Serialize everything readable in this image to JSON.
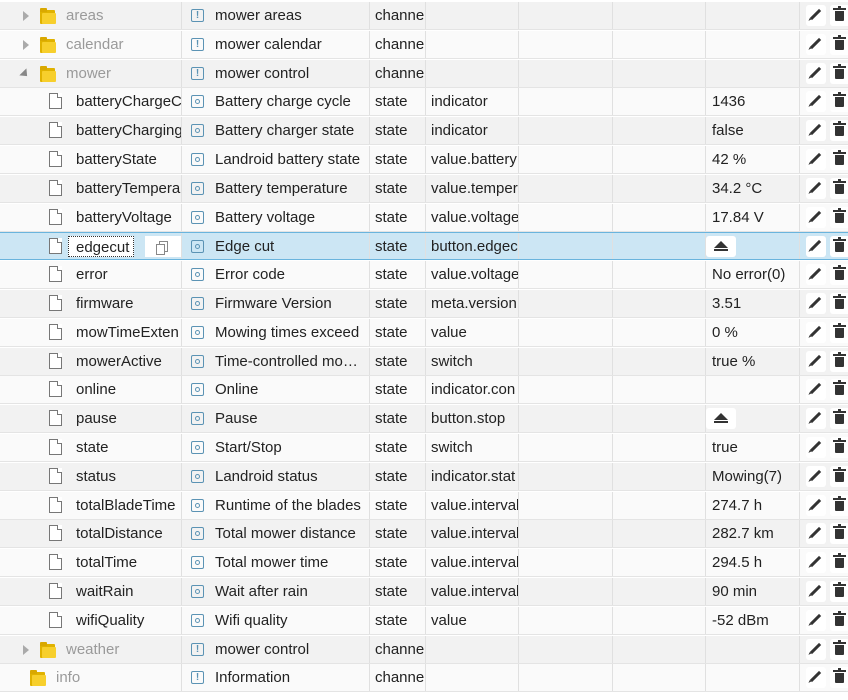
{
  "rows": [
    {
      "kind": "folder",
      "state": "closed",
      "level": 1,
      "id": "areas",
      "name": "mower areas",
      "type": "channe",
      "role": "",
      "value": ""
    },
    {
      "kind": "folder",
      "state": "closed",
      "level": 1,
      "id": "calendar",
      "name": "mower calendar",
      "type": "channe",
      "role": "",
      "value": ""
    },
    {
      "kind": "folder",
      "state": "open",
      "level": 1,
      "id": "mower",
      "name": "mower control",
      "type": "channe",
      "role": "",
      "value": ""
    },
    {
      "kind": "state",
      "id": "batteryChargeC",
      "name": "Battery charge cycle",
      "type": "state",
      "role": "indicator",
      "value": "1436"
    },
    {
      "kind": "state",
      "id": "batteryCharging",
      "name": "Battery charger state",
      "type": "state",
      "role": "indicator",
      "value": "false"
    },
    {
      "kind": "state",
      "id": "batteryState",
      "name": "Landroid battery state",
      "type": "state",
      "role": "value.battery",
      "value": "42 %"
    },
    {
      "kind": "state",
      "id": "batteryTempera",
      "name": "Battery temperature",
      "type": "state",
      "role": "value.temper",
      "value": "34.2 °C"
    },
    {
      "kind": "state",
      "id": "batteryVoltage",
      "name": "Battery voltage",
      "type": "state",
      "role": "value.voltage",
      "value": "17.84 V"
    },
    {
      "kind": "state",
      "id": "edgecut",
      "name": "Edge cut",
      "type": "state",
      "role": "button.edgec",
      "value": "",
      "button": true,
      "selected": true
    },
    {
      "kind": "state",
      "id": "error",
      "name": "Error code",
      "type": "state",
      "role": "value.voltage",
      "value": "No error(0)"
    },
    {
      "kind": "state",
      "id": "firmware",
      "name": "Firmware Version",
      "type": "state",
      "role": "meta.version",
      "value": "3.51"
    },
    {
      "kind": "state",
      "id": "mowTimeExten",
      "name": "Mowing times exceed",
      "type": "state",
      "role": "value",
      "value": "0 %"
    },
    {
      "kind": "state",
      "id": "mowerActive",
      "name": "Time-controlled mow…",
      "type": "state",
      "role": "switch",
      "value": "true %"
    },
    {
      "kind": "state",
      "id": "online",
      "name": "Online",
      "type": "state",
      "role": "indicator.con",
      "value": ""
    },
    {
      "kind": "state",
      "id": "pause",
      "name": "Pause",
      "type": "state",
      "role": "button.stop",
      "value": "",
      "button": true
    },
    {
      "kind": "state",
      "id": "state",
      "name": "Start/Stop",
      "type": "state",
      "role": "switch",
      "value": "true"
    },
    {
      "kind": "state",
      "id": "status",
      "name": "Landroid status",
      "type": "state",
      "role": "indicator.stat",
      "value": "Mowing(7)"
    },
    {
      "kind": "state",
      "id": "totalBladeTime",
      "name": "Runtime of the blades",
      "type": "state",
      "role": "value.interval",
      "value": "274.7 h"
    },
    {
      "kind": "state",
      "id": "totalDistance",
      "name": "Total mower distance",
      "type": "state",
      "role": "value.interval",
      "value": "282.7 km"
    },
    {
      "kind": "state",
      "id": "totalTime",
      "name": "Total mower time",
      "type": "state",
      "role": "value.interval",
      "value": "294.5 h"
    },
    {
      "kind": "state",
      "id": "waitRain",
      "name": "Wait after rain",
      "type": "state",
      "role": "value.interval",
      "value": "90 min"
    },
    {
      "kind": "state",
      "id": "wifiQuality",
      "name": "Wifi quality",
      "type": "state",
      "role": "value",
      "value": "-52 dBm"
    },
    {
      "kind": "folder",
      "state": "closed",
      "level": 1,
      "id": "weather",
      "name": "mower control",
      "type": "channe",
      "role": "",
      "value": ""
    },
    {
      "kind": "folder",
      "state": "none",
      "level": 0,
      "id": "info",
      "name": "Information",
      "type": "channe",
      "role": "",
      "value": ""
    }
  ],
  "icons": {
    "folder": "folder-icon",
    "state": "state-icon",
    "channel": "channel-icon",
    "edit": "pencil-icon",
    "delete": "trash-icon",
    "copy": "copy-icon",
    "button": "eject-button-icon"
  },
  "colors": {
    "selected_row": "#cce6f4",
    "folder": "#f7cf2c",
    "dim_text": "#9a9a9a"
  }
}
